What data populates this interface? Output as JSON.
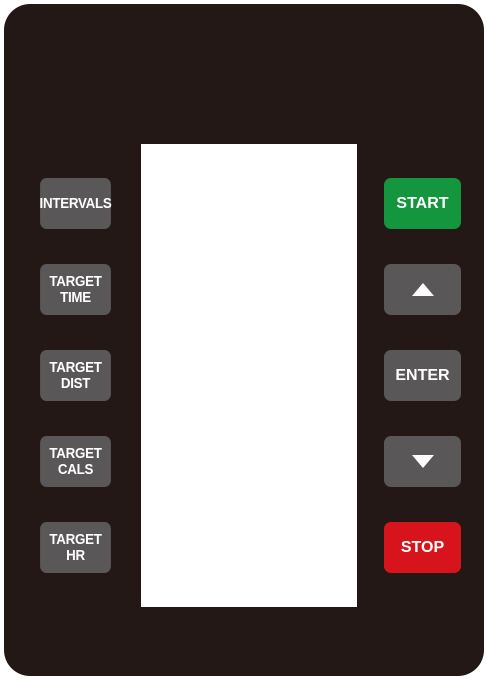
{
  "left_buttons": {
    "intervals": "INTERVALS",
    "target_time": {
      "line1": "TARGET",
      "line2": "TIME"
    },
    "target_dist": {
      "line1": "TARGET",
      "line2": "DIST"
    },
    "target_cals": {
      "line1": "TARGET",
      "line2": "CALS"
    },
    "target_hr": {
      "line1": "TARGET",
      "line2": "HR"
    }
  },
  "right_buttons": {
    "start": "START",
    "up_icon": "triangle-up-icon",
    "enter": "ENTER",
    "down_icon": "triangle-down-icon",
    "stop": "STOP"
  },
  "colors": {
    "panel": "#231815",
    "button_gray": "#595757",
    "start_green": "#14963e",
    "stop_red": "#d7141b",
    "display": "#ffffff"
  }
}
